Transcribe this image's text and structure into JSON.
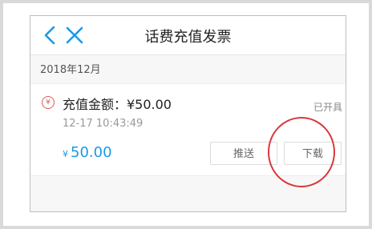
{
  "header": {
    "title": "话费充值发票",
    "back_icon": "chevron-left-icon",
    "close_icon": "close-icon",
    "accent_color": "#1a9be6"
  },
  "month": "2018年12月",
  "record": {
    "icon": "yen-circle-icon",
    "icon_glyph": "¥",
    "amount_label": "充值金额：¥50.00",
    "status": "已开具",
    "time": "12-17 10:43:49",
    "price_symbol": "¥",
    "price_value": "50.00",
    "push_label": "推送",
    "download_label": "下载"
  },
  "annotation": {
    "color": "#d9383a"
  }
}
